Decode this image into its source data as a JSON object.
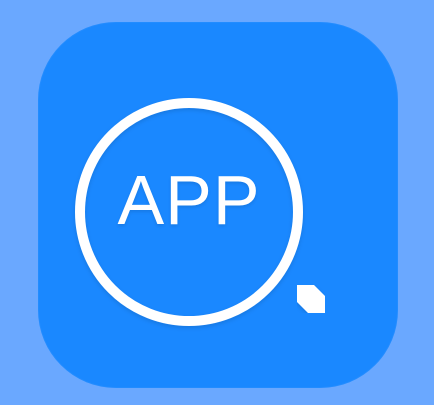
{
  "icon": {
    "name": "app-search-icon",
    "label": "APP",
    "background_color": "#1a88ff",
    "page_background_color": "#6aa8ff",
    "glyph_color": "#ffffff",
    "glyph": "magnifier-icon"
  }
}
